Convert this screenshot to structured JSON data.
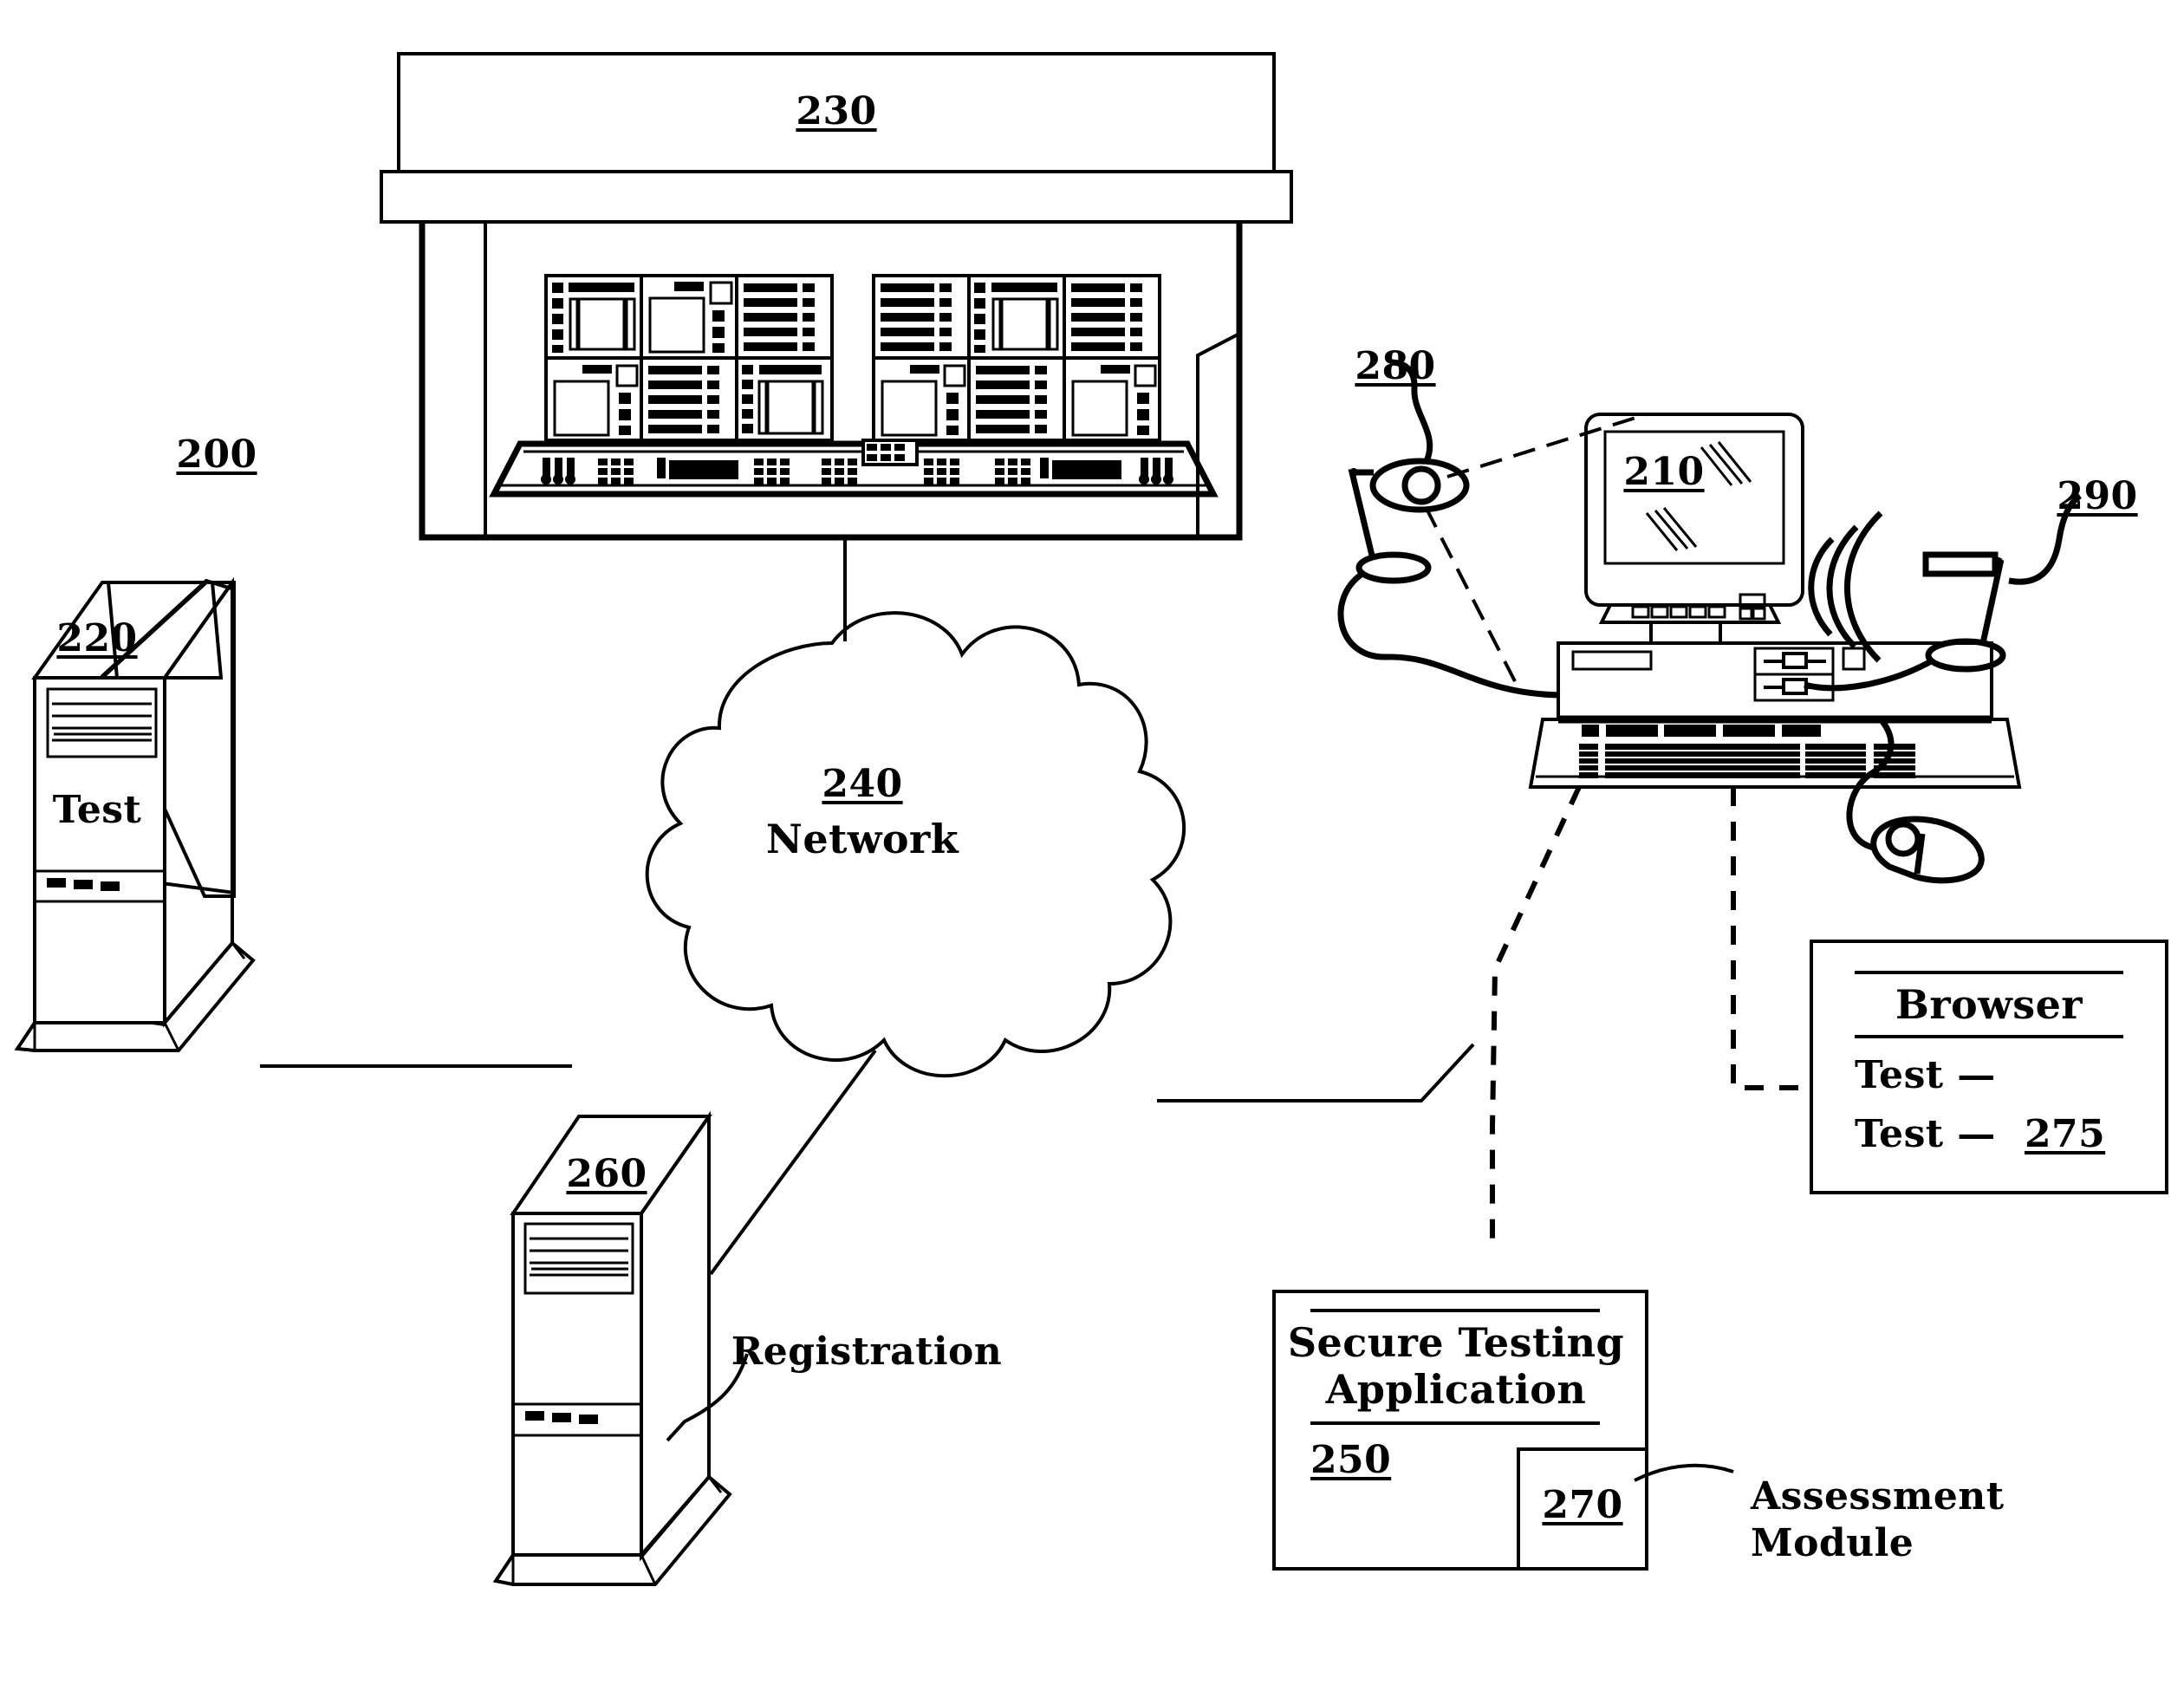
{
  "figure": {
    "type": "patent-diagram",
    "title_ref": "200",
    "system_ref_label": "200"
  },
  "nodes": {
    "system": {
      "ref": "200",
      "name": "system-reference-numeral"
    },
    "mainframe": {
      "ref": "230",
      "name": "mainframe-server-rack"
    },
    "test_server": {
      "ref": "220",
      "label": "Test",
      "name": "test-server-tower"
    },
    "registration_server": {
      "ref": "260",
      "label": "Registration",
      "name": "registration-server-tower"
    },
    "network": {
      "ref": "240",
      "label": "Network",
      "name": "network-cloud"
    },
    "workstation": {
      "ref": "210",
      "name": "client-workstation-monitor"
    },
    "camera": {
      "ref": "280",
      "name": "webcam-device"
    },
    "microphone": {
      "ref": "290",
      "name": "microphone-device"
    },
    "browser": {
      "ref": "275",
      "title": "Browser",
      "line1": "Test —",
      "line2": "Test —",
      "name": "browser-window-box"
    },
    "secure_testing_app": {
      "ref": "250",
      "title_line1": "Secure Testing",
      "title_line2": "Application",
      "name": "secure-testing-application-box"
    },
    "assessment_module": {
      "ref": "270",
      "label_line1": "Assessment",
      "label_line2": "Module",
      "name": "assessment-module-box"
    }
  },
  "colors": {
    "line": "#000000",
    "background": "#ffffff"
  }
}
